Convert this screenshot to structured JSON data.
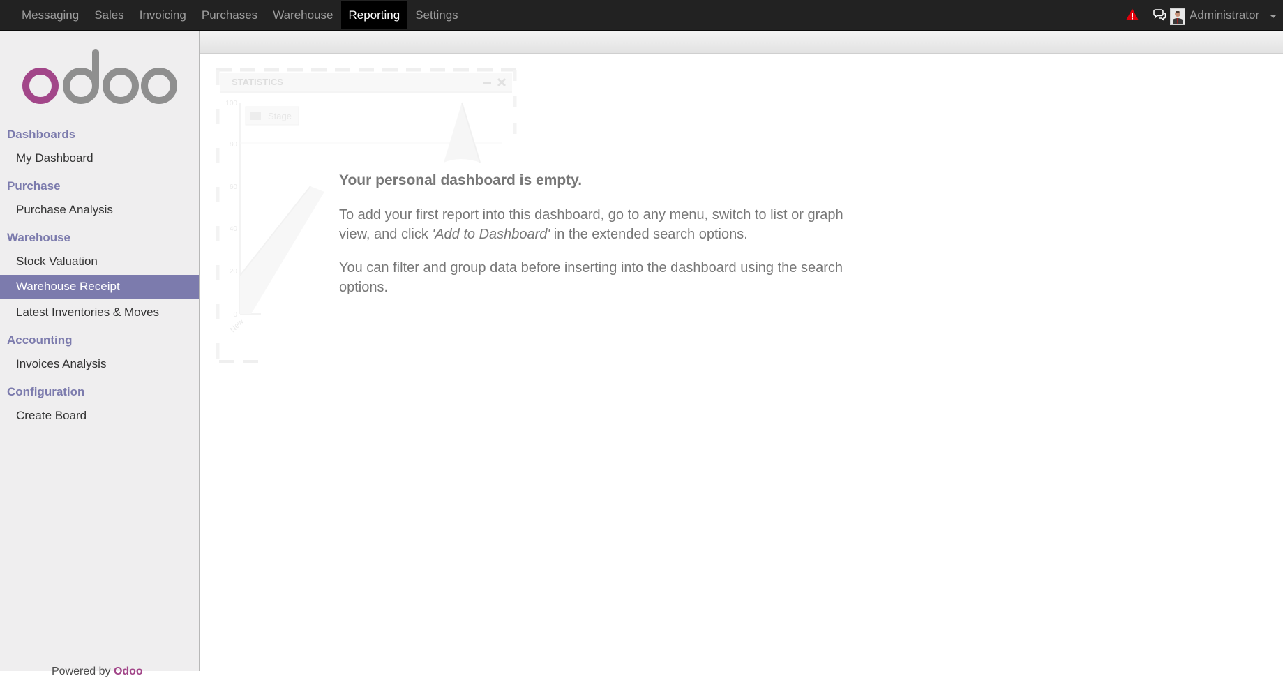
{
  "topbar": {
    "menu": [
      {
        "label": "Messaging"
      },
      {
        "label": "Sales"
      },
      {
        "label": "Invoicing"
      },
      {
        "label": "Purchases"
      },
      {
        "label": "Warehouse"
      },
      {
        "label": "Reporting",
        "active": true
      },
      {
        "label": "Settings"
      }
    ],
    "user": {
      "name": "Administrator"
    },
    "icons": [
      "warning-icon",
      "chat-icon",
      "avatar",
      "chevron-down-icon"
    ],
    "colors": {
      "background": "#222222",
      "active_background": "#000000",
      "warning": "#e0000b"
    }
  },
  "sidebar": {
    "sections": [
      {
        "title": "Dashboards",
        "items": [
          {
            "label": "My Dashboard"
          }
        ]
      },
      {
        "title": "Purchase",
        "items": [
          {
            "label": "Purchase Analysis"
          }
        ]
      },
      {
        "title": "Warehouse",
        "items": [
          {
            "label": "Stock Valuation"
          },
          {
            "label": "Warehouse Receipt",
            "active": true
          },
          {
            "label": "Latest Inventories & Moves"
          }
        ]
      },
      {
        "title": "Accounting",
        "items": [
          {
            "label": "Invoices Analysis"
          }
        ]
      },
      {
        "title": "Configuration",
        "items": [
          {
            "label": "Create Board"
          }
        ]
      }
    ],
    "footer": {
      "prefix": "Powered by ",
      "brand": "Odoo"
    },
    "colors": {
      "section": "#7c7bad",
      "active_item": "#7c7bad",
      "background": "#efeeef"
    }
  },
  "dashboard": {
    "ghost_widget": {
      "title": "STATISTICS",
      "legend": "Stage",
      "y_ticks": [
        "100",
        "80",
        "60",
        "40",
        "20",
        "0"
      ],
      "x_tick": "New"
    },
    "empty_title": "Your personal dashboard is empty.",
    "help_1_before": "To add your first report into this dashboard, go to any menu, switch to list or graph view, and click ",
    "help_1_emphasis": "'Add to Dashboard'",
    "help_1_after": " in the extended search options.",
    "help_2": "You can filter and group data before inserting into the dashboard using the search options."
  }
}
